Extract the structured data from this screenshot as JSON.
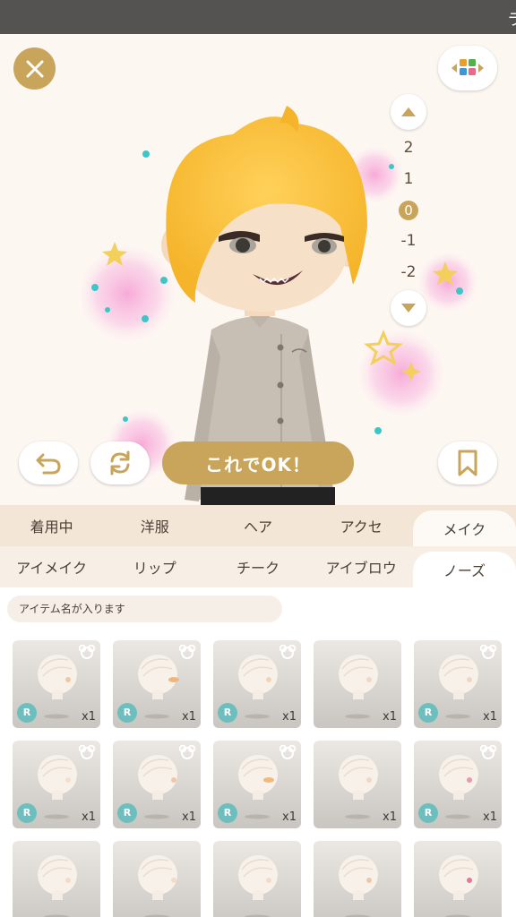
{
  "topbar": {
    "clipped_text": "ラ"
  },
  "zoom": {
    "levels": [
      "2",
      "1",
      "0",
      "-1",
      "-2"
    ],
    "current": "0"
  },
  "actions": {
    "ok_label": "これでOK！"
  },
  "tabs_main": [
    {
      "label": "着用中",
      "active": false
    },
    {
      "label": "洋服",
      "active": false
    },
    {
      "label": "ヘア",
      "active": false
    },
    {
      "label": "アクセ",
      "active": false
    },
    {
      "label": "メイク",
      "active": true
    }
  ],
  "tabs_sub": [
    {
      "label": "アイメイク",
      "active": false
    },
    {
      "label": "リップ",
      "active": false
    },
    {
      "label": "チーク",
      "active": false
    },
    {
      "label": "アイブロウ",
      "active": false
    },
    {
      "label": "ノーズ",
      "active": true
    }
  ],
  "item_name_placeholder": "アイテム名が入ります",
  "items": [
    {
      "rarity": "R",
      "qty": "x1",
      "bear": true,
      "nose": "#f2c6a0"
    },
    {
      "rarity": "R",
      "qty": "x1",
      "bear": true,
      "nose": "#efb57f"
    },
    {
      "rarity": "R",
      "qty": "x1",
      "bear": true,
      "nose": "#f3d3b6"
    },
    {
      "rarity": "",
      "qty": "x1",
      "bear": false,
      "nose": "#efd8c4"
    },
    {
      "rarity": "R",
      "qty": "x1",
      "bear": true,
      "nose": "#f0d6c0"
    },
    {
      "rarity": "R",
      "qty": "x1",
      "bear": true,
      "nose": "#f3dfcf"
    },
    {
      "rarity": "R",
      "qty": "x1",
      "bear": true,
      "nose": "#f0c8a8"
    },
    {
      "rarity": "R",
      "qty": "x1",
      "bear": true,
      "nose": "#f2b97c"
    },
    {
      "rarity": "",
      "qty": "x1",
      "bear": false,
      "nose": "#efd8c4"
    },
    {
      "rarity": "R",
      "qty": "x1",
      "bear": true,
      "nose": "#e89aa8"
    },
    {
      "rarity": "",
      "qty": "",
      "bear": false,
      "nose": "#f2dcc8"
    },
    {
      "rarity": "",
      "qty": "",
      "bear": false,
      "nose": "#f2dcc8"
    },
    {
      "rarity": "",
      "qty": "",
      "bear": false,
      "nose": "#f2dcc8"
    },
    {
      "rarity": "",
      "qty": "",
      "bear": false,
      "nose": "#efc7a6"
    },
    {
      "rarity": "",
      "qty": "",
      "bear": false,
      "nose": "#e07a98"
    }
  ],
  "colors": {
    "accent": "#c9a55c",
    "rarity_badge": "#6cbfbe"
  }
}
